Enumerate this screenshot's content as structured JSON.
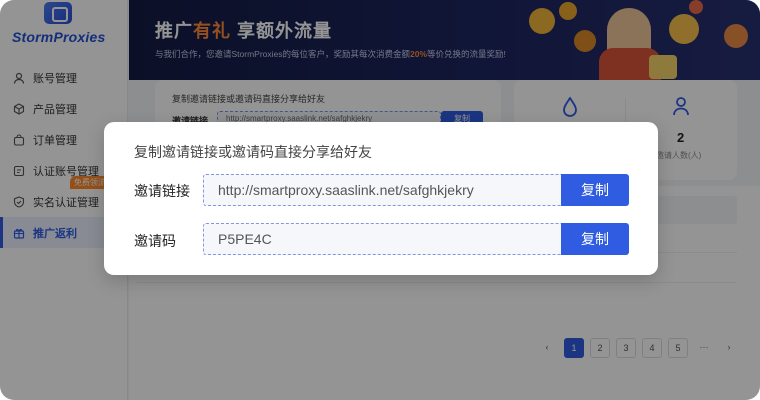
{
  "app": {
    "logo_text": "StormProxies"
  },
  "sidebar": {
    "items": [
      {
        "label": "账号管理",
        "icon": "user-icon"
      },
      {
        "label": "产品管理",
        "icon": "cube-icon"
      },
      {
        "label": "订单管理",
        "icon": "bag-icon"
      },
      {
        "label": "认证账号管理",
        "icon": "id-card-icon"
      },
      {
        "label": "实名认证管理",
        "icon": "shield-icon",
        "badge": "免费领流"
      },
      {
        "label": "推广返利",
        "icon": "gift-icon",
        "active": true
      }
    ]
  },
  "banner": {
    "title_a": "推广",
    "title_hl": "有礼",
    "title_b": " 享额外流量",
    "subtitle_a": "与我们合作，您邀请StormProxies的每位客户，奖励其每次消费金额",
    "subtitle_pct": "20%",
    "subtitle_b": "等价兑换的流量奖励!"
  },
  "background_card": {
    "title": "复制邀请链接或邀请码直接分享给好友",
    "link_label": "邀请链接",
    "link_value": "http://smartproxy.saaslink.net/safghkjekry",
    "copy_label": "复制"
  },
  "stats": {
    "invited_value": "2",
    "invited_label": "邀请人数(人)"
  },
  "pagination": {
    "prev": "‹",
    "pages": [
      "1",
      "2",
      "3",
      "4",
      "5"
    ],
    "current": "1",
    "ellipsis": "···",
    "next": "›"
  },
  "modal": {
    "title": "复制邀请链接或邀请码直接分享给好友",
    "link_label": "邀请链接",
    "link_value": "http://smartproxy.saaslink.net/safghkjekry",
    "code_label": "邀请码",
    "code_value": "P5PE4C",
    "copy_label": "复制"
  },
  "colors": {
    "accent": "#2f5ce0",
    "highlight": "#ff8a3a",
    "banner_bg": "#1d2660"
  }
}
